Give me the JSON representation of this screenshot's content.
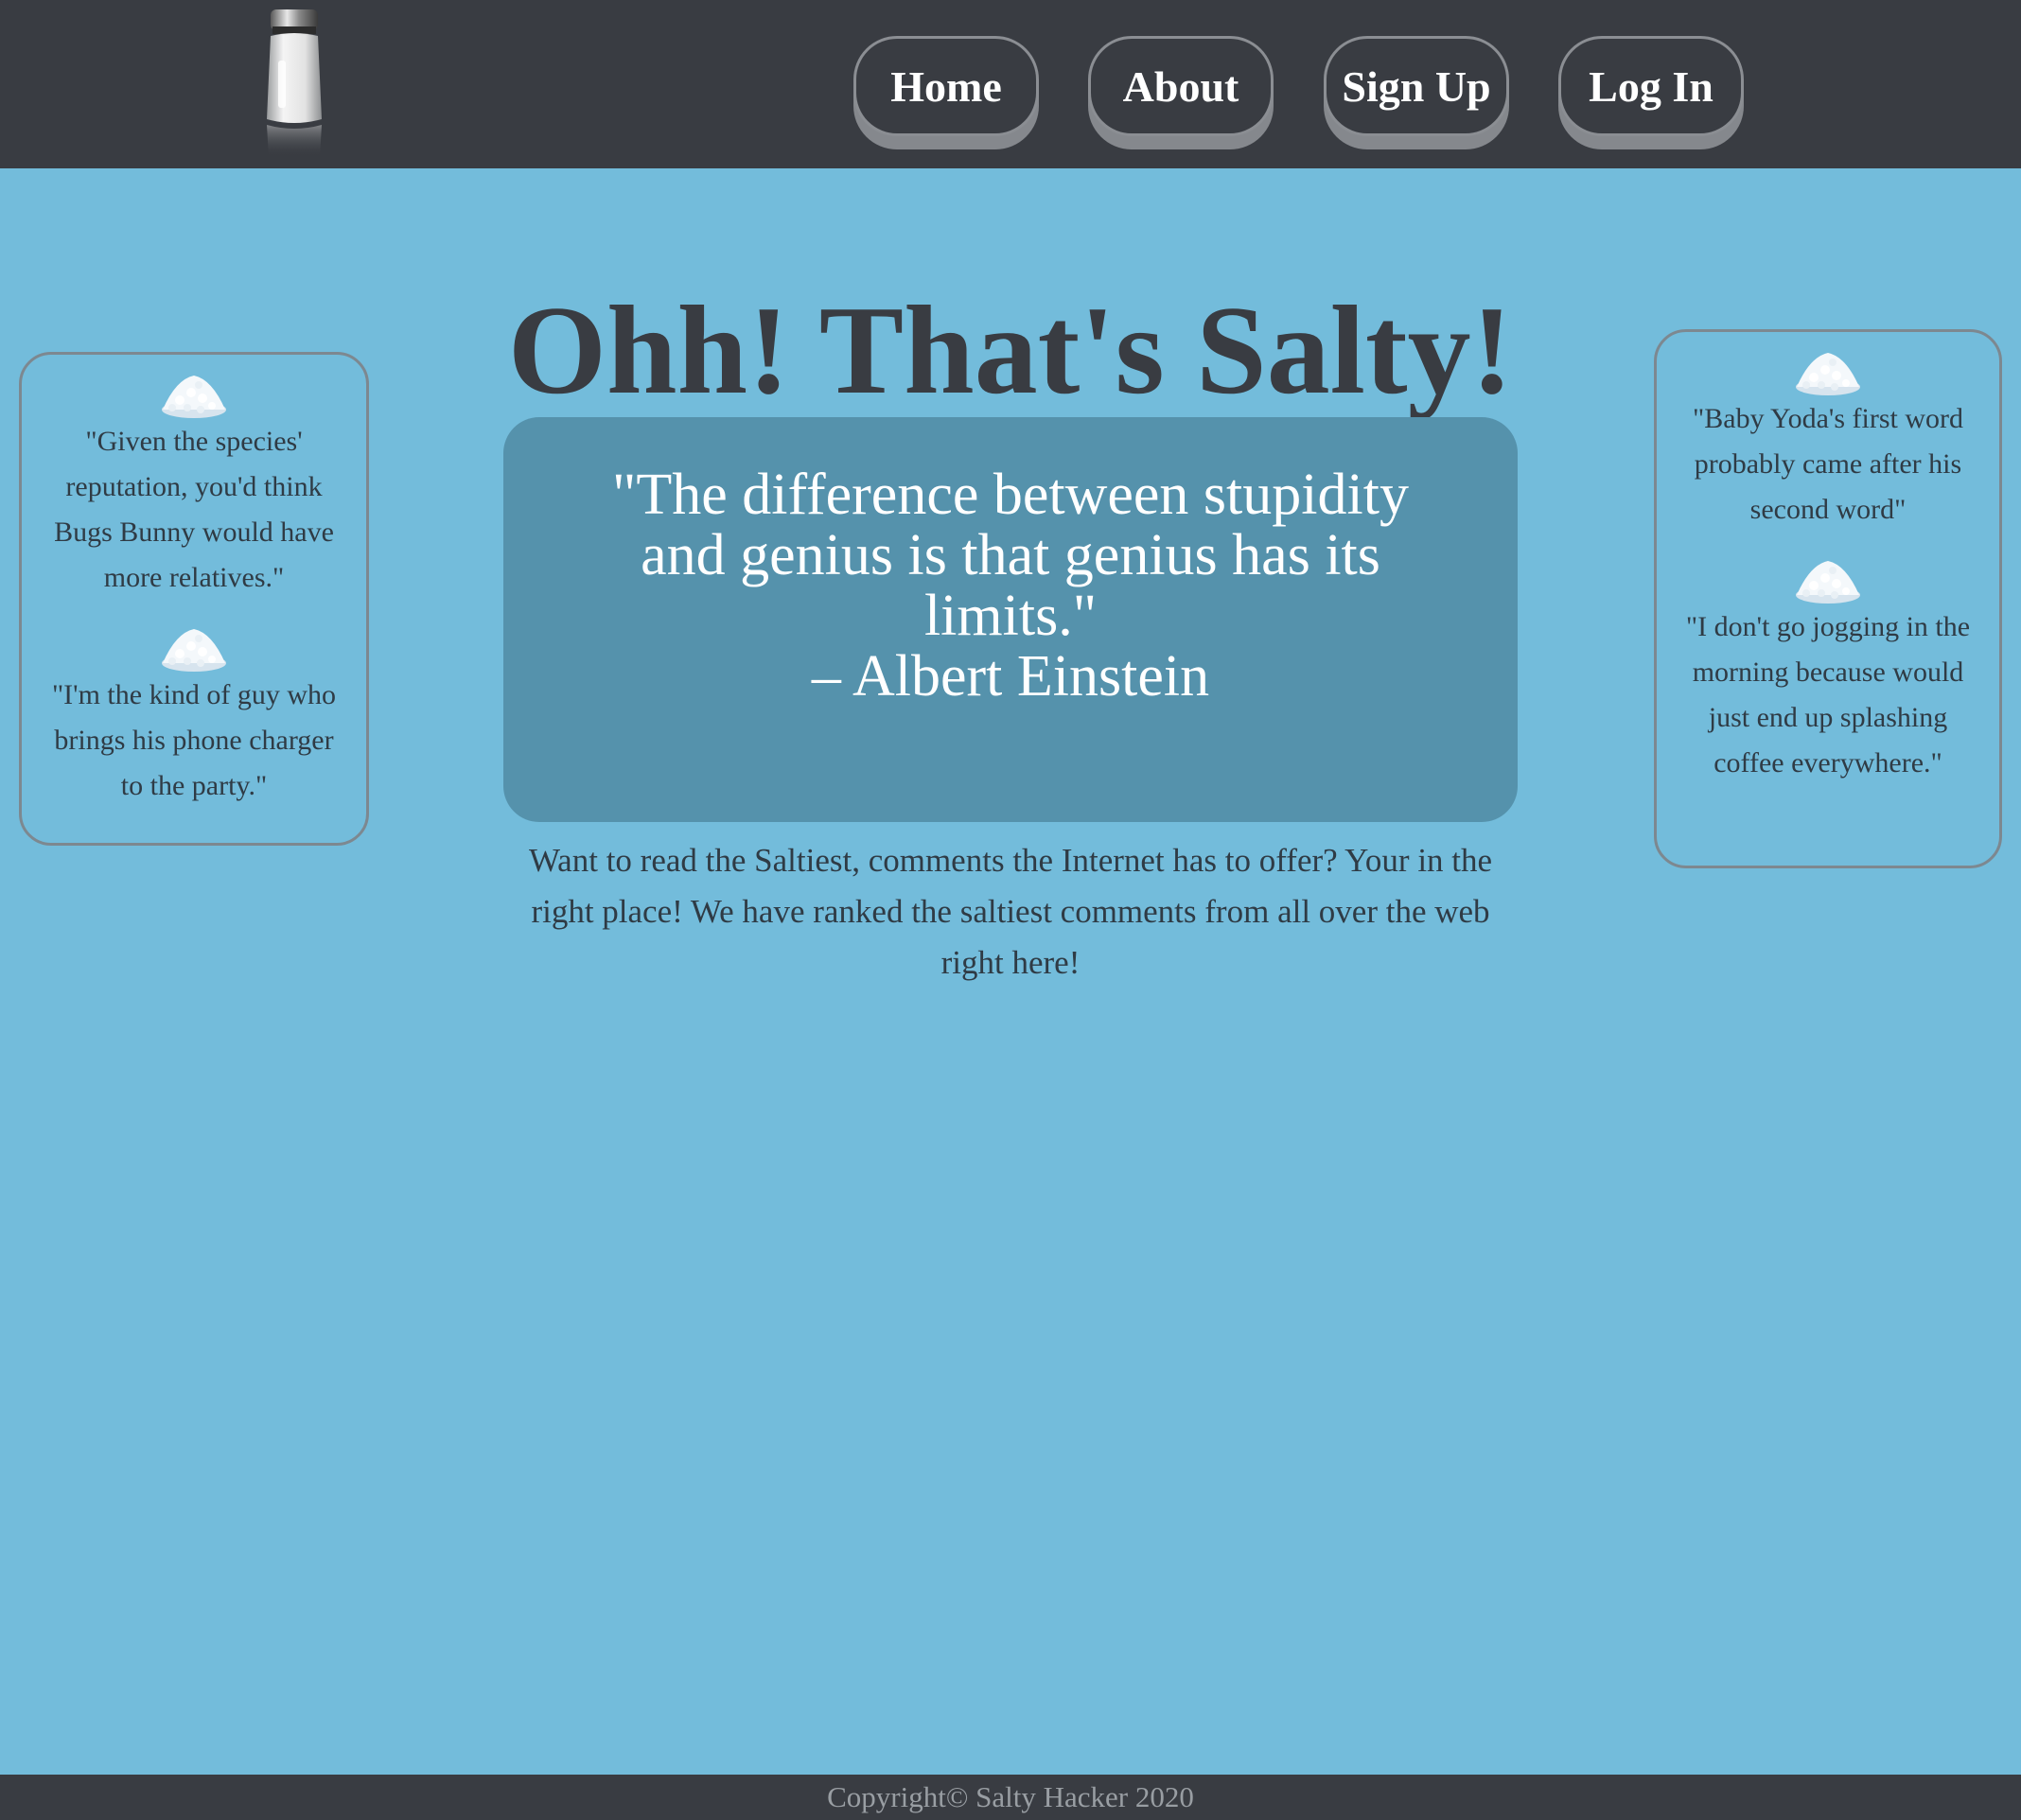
{
  "nav": {
    "home": "Home",
    "about": "About",
    "signup": "Sign Up",
    "login": "Log In"
  },
  "title": "Ohh! That's Salty!",
  "featured_quote": {
    "text": "\"The difference between stupidity and genius is that genius has its limits.\"",
    "author": "– Albert Einstein"
  },
  "intro": "Want to read the Saltiest, comments the Internet has to offer? Your in the right place! We have ranked the saltiest comments from all over the web right here!",
  "left_quotes": [
    "\"Given the species' reputation, you'd think Bugs Bunny would have more relatives.\"",
    "\"I'm the kind of guy who brings his phone charger to the party.\""
  ],
  "right_quotes": [
    "\"Baby Yoda's first word probably came after his second word\"",
    "\"I don't go jogging in the morning because would just end up splashing coffee everywhere.\""
  ],
  "footer": "Copyright© Salty Hacker 2020",
  "colors": {
    "background": "#73bcdb",
    "header": "#393c42",
    "quote_box": "#5592ac",
    "text_dark": "#393c42"
  },
  "icons": {
    "logo": "salt-shaker-icon",
    "card_icon": "salt-pile-icon"
  }
}
